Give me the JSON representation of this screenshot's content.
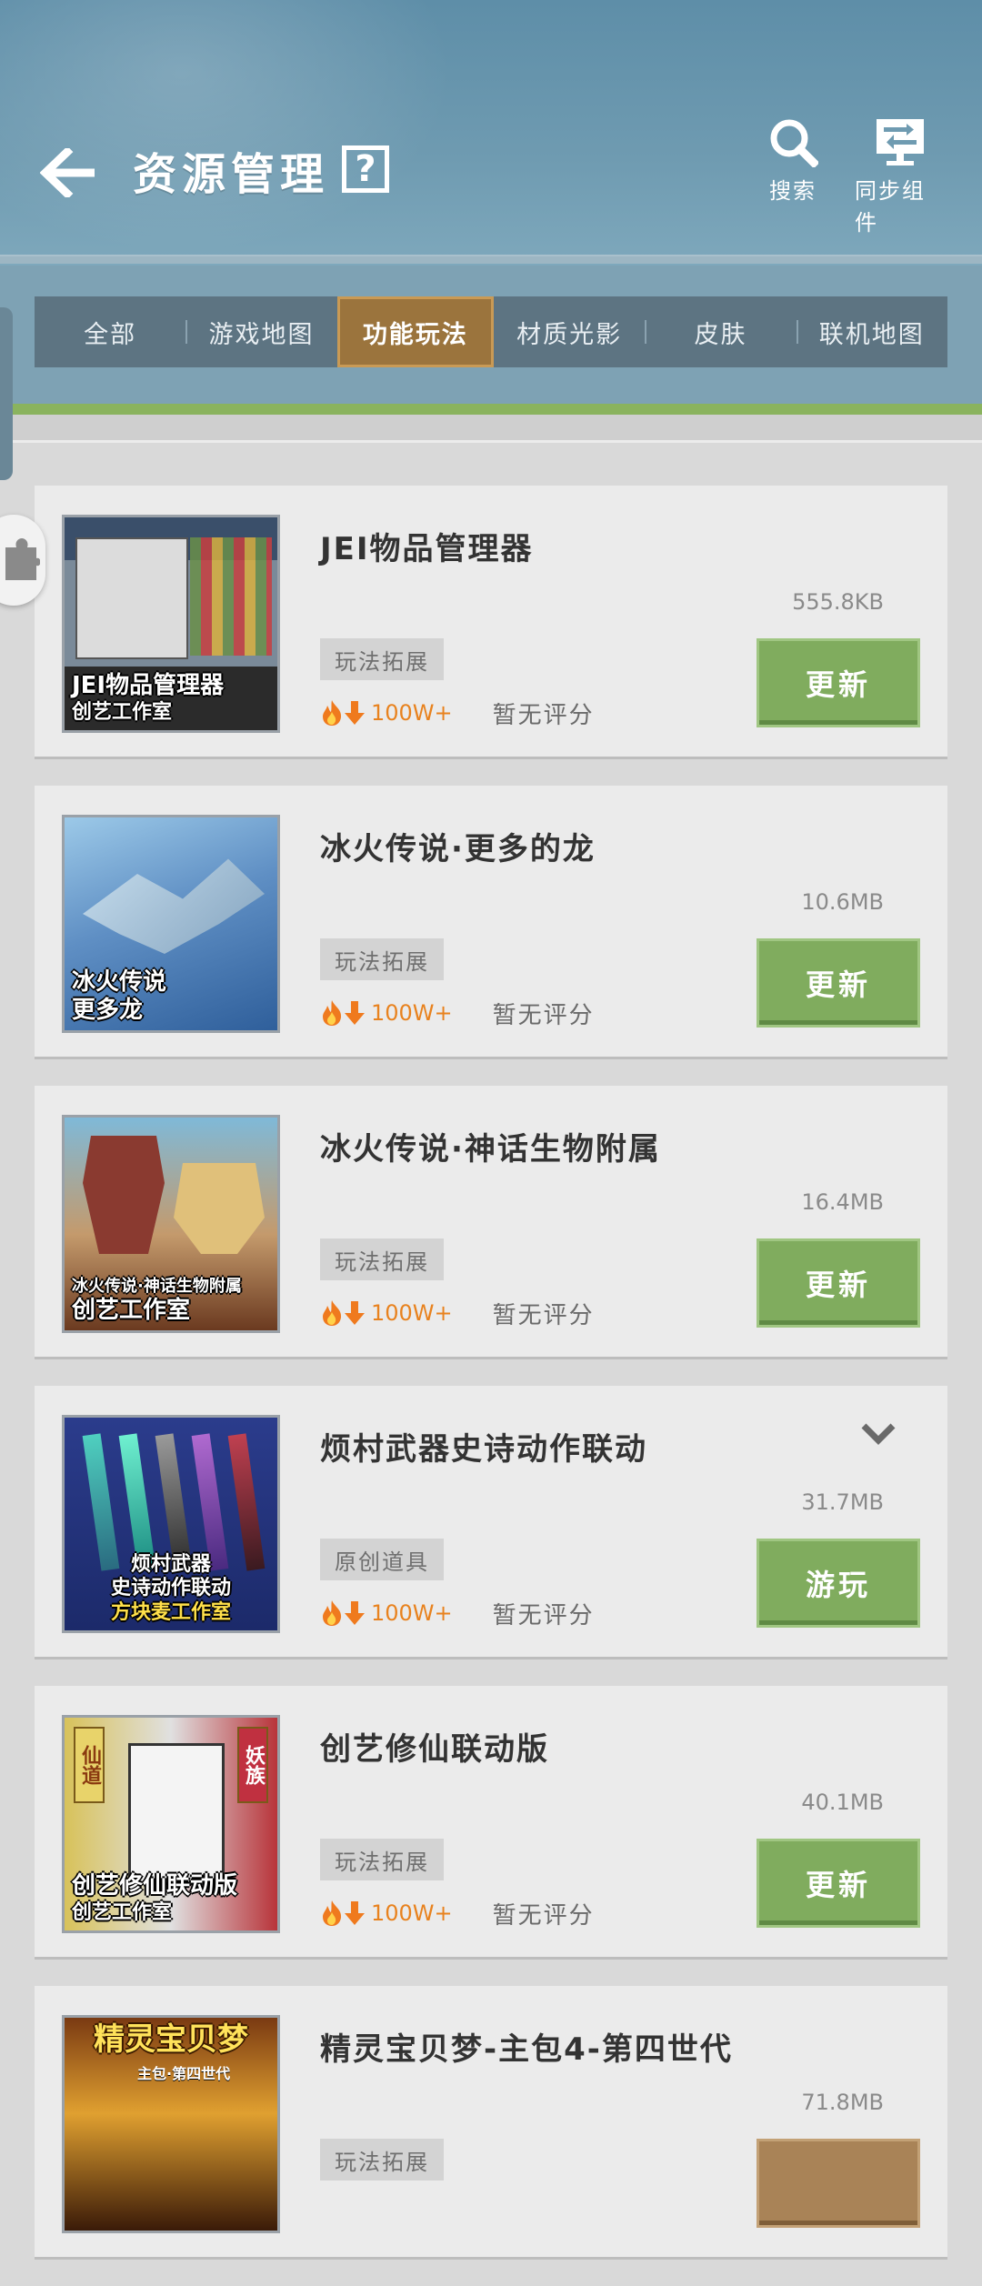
{
  "header": {
    "title": "资源管理",
    "help_label": "?",
    "search_label": "搜索",
    "sync_label": "同步组件"
  },
  "tabs": [
    {
      "label": "全部",
      "active": false
    },
    {
      "label": "游戏地图",
      "active": false
    },
    {
      "label": "功能玩法",
      "active": true
    },
    {
      "label": "材质光影",
      "active": false
    },
    {
      "label": "皮肤",
      "active": false
    },
    {
      "label": "联机地图",
      "active": false
    }
  ],
  "colors": {
    "header": "#6f9bb1",
    "active_tab": "#9b743d",
    "update_button": "#80ac5e",
    "download_count": "#e8821e",
    "green_bar": "#8ab35e"
  },
  "items": [
    {
      "name": "JEI物品管理器",
      "size": "555.8KB",
      "tag": "玩法拓展",
      "downloads": "100W+",
      "rating": "暂无评分",
      "button": "更新",
      "thumb_caption": [
        "JEI物品管理器",
        "创艺工作室"
      ]
    },
    {
      "name": "冰火传说·更多的龙",
      "size": "10.6MB",
      "tag": "玩法拓展",
      "downloads": "100W+",
      "rating": "暂无评分",
      "button": "更新",
      "thumb_caption": [
        "冰火传说",
        "更多龙"
      ]
    },
    {
      "name": "冰火传说·神话生物附属",
      "size": "16.4MB",
      "tag": "玩法拓展",
      "downloads": "100W+",
      "rating": "暂无评分",
      "button": "更新",
      "thumb_caption": [
        "冰火传说·神话生物附属",
        "创艺工作室"
      ]
    },
    {
      "name": "烦村武器史诗动作联动",
      "size": "31.7MB",
      "tag": "原创道具",
      "downloads": "100W+",
      "rating": "暂无评分",
      "button": "游玩",
      "thumb_caption": [
        "烦村武器",
        "史诗动作联动",
        "方块麦工作室"
      ]
    },
    {
      "name": "创艺修仙联动版",
      "size": "40.1MB",
      "tag": "玩法拓展",
      "downloads": "100W+",
      "rating": "暂无评分",
      "button": "更新",
      "thumb_caption": [
        "创艺修仙联动版",
        "创艺工作室"
      ],
      "thumb_side": [
        "仙道",
        "妖族"
      ]
    },
    {
      "name": "精灵宝贝梦-主包4-第四世代",
      "size": "71.8MB",
      "tag": "玩法拓展",
      "thumb_caption": [
        "精灵宝贝梦",
        "主包·第四世代"
      ]
    }
  ]
}
